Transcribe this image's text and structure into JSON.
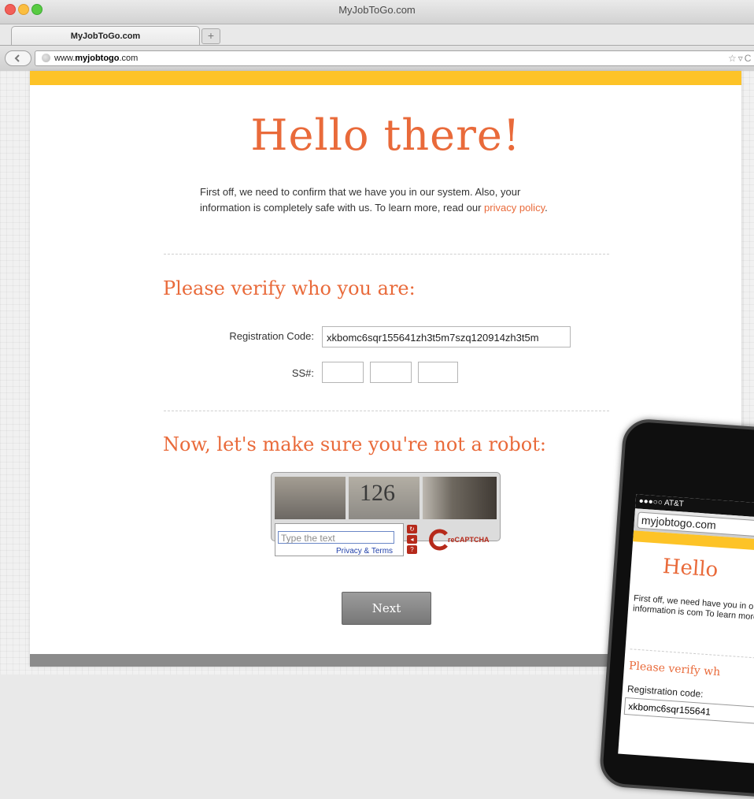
{
  "window": {
    "title": "MyJobToGo.com"
  },
  "tab": {
    "label": "MyJobToGo.com",
    "new_tab_icon": "plus-icon"
  },
  "urlbar": {
    "prefix": "www.",
    "domain": "myjobtogo",
    "suffix": ".com"
  },
  "page": {
    "title": "Hello there!",
    "intro_text": "First off, we need to confirm that we have you in our system. Also, your information is completely safe with us. To learn more, read our ",
    "intro_link": "privacy policy",
    "intro_end": ".",
    "verify_heading": "Please verify who you are:",
    "registration_label": "Registration Code:",
    "registration_value": "xkbomc6sqr155641zh3t5m7szq120914zh3t5m",
    "ss_label": "SS#:",
    "robot_heading": "Now, let's make sure you're not a robot:",
    "captcha": {
      "image_text": "126",
      "input_placeholder": "Type the text",
      "privacy_link": "Privacy & Terms",
      "brand": "reCAPTCHA"
    },
    "next_label": "Next"
  },
  "phone": {
    "carrier": "●●●○○ AT&T",
    "url": "myjobtogo.com",
    "title": "Hello",
    "text": "First off, we need have you in our sy information is com To learn more, rea",
    "heading": "Please verify wh",
    "registration_label": "Registration code:",
    "registration_value": "xkbomc6sqr155641"
  },
  "colors": {
    "accent": "#e96a3a",
    "bar": "#fdc327"
  }
}
